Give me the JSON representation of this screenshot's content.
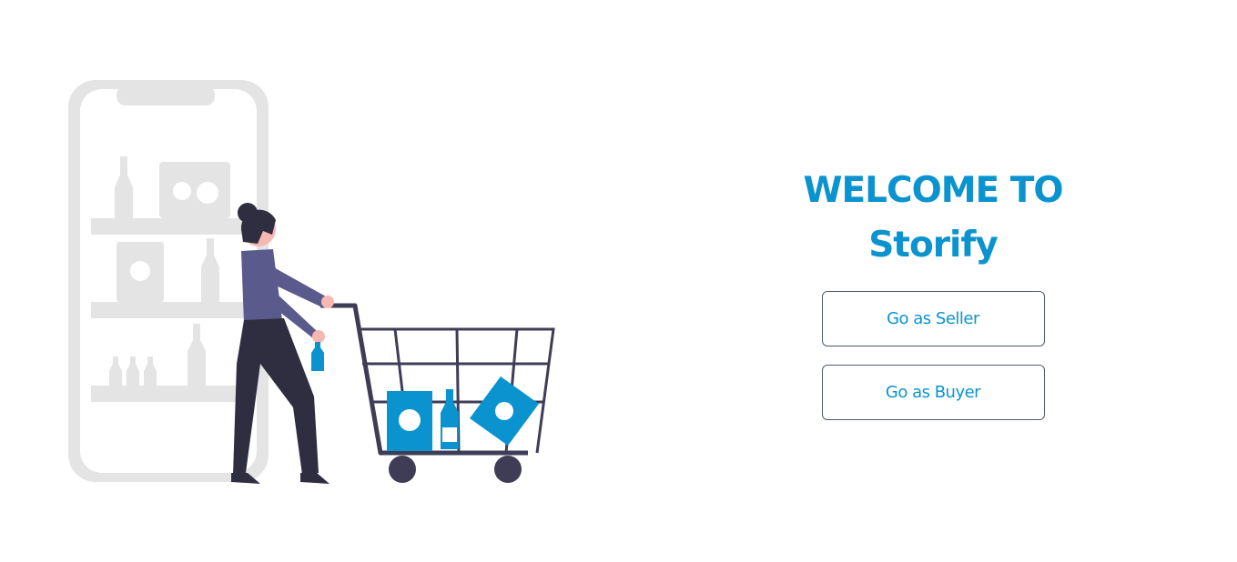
{
  "brand": {
    "accent": "#0a93cf",
    "illustration_gray": "#e4e4e4",
    "illustration_dark": "#2f2e41",
    "illustration_shirt": "#5b5a8c",
    "illustration_skin": "#f6b8b1"
  },
  "hero": {
    "illustration": "shopping-cart-illustration"
  },
  "welcome": {
    "line1": "WELCOME TO",
    "line2": "Storify"
  },
  "actions": {
    "seller_label": "Go as Seller",
    "buyer_label": "Go as Buyer"
  }
}
